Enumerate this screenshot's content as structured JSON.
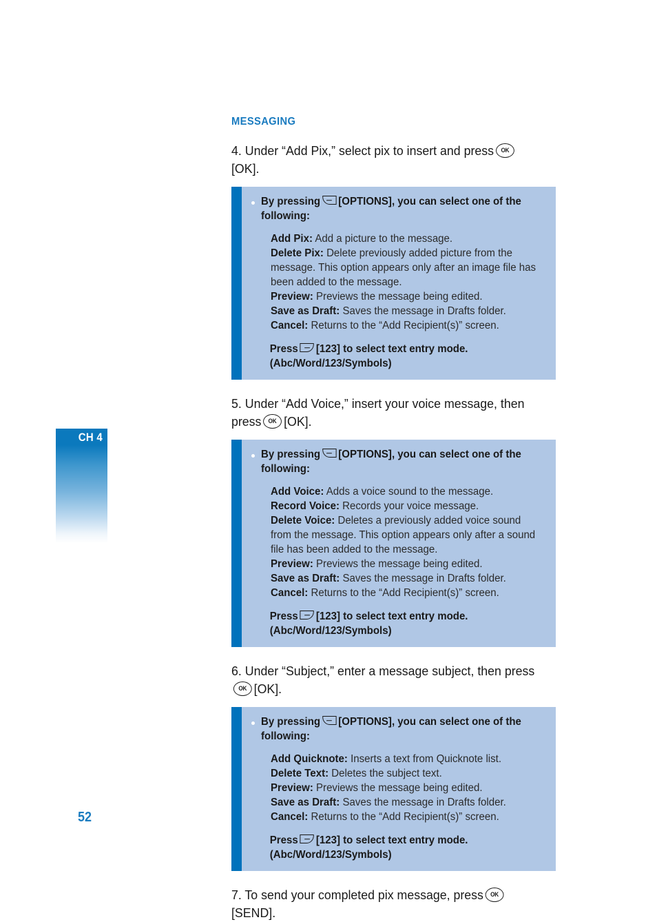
{
  "chapter_tab": {
    "label": "CH 4"
  },
  "page_number": "52",
  "section_heading": "MESSAGING",
  "icons": {
    "ok_key_label": "OK",
    "soft_key_left": "left-soft-key",
    "soft_key_right": "right-soft-key"
  },
  "steps": {
    "step4": {
      "before_icon": "4. Under “Add Pix,” select pix to insert and press",
      "after_icon": "[OK]."
    },
    "step5": {
      "before_icon": "5. Under “Add Voice,” insert your voice message, then press",
      "after_icon": "[OK]."
    },
    "step6": {
      "before_icon": "6. Under “Subject,” enter a message subject, then press",
      "after_icon": "[OK]."
    },
    "step7": {
      "before_icon": "7. To send your completed pix message, press",
      "after_icon": "[SEND]."
    }
  },
  "callouts": [
    {
      "lead_before_icon": "By pressing",
      "lead_after_icon": "[OPTIONS], you can select one of the following:",
      "options": [
        {
          "name": "Add Pix:",
          "desc": " Add a picture to the message."
        },
        {
          "name": "Delete Pix:",
          "desc": " Delete previously added picture from the message. This option appears only after an image file has been added to the message."
        },
        {
          "name": "Preview:",
          "desc": " Previews the message being edited."
        },
        {
          "name": "Save as Draft:",
          "desc": " Saves the message in Drafts folder."
        },
        {
          "name": "Cancel:",
          "desc": " Returns to the “Add Recipient(s)” screen."
        }
      ],
      "footer_before_icon": "Press",
      "footer_after_icon": "[123] to select text entry mode. (Abc/Word/123/Symbols)"
    },
    {
      "lead_before_icon": "By pressing",
      "lead_after_icon": "[OPTIONS], you can select one of  the following:",
      "options": [
        {
          "name": "Add Voice:",
          "desc": " Adds a voice sound to the message."
        },
        {
          "name": "Record Voice:",
          "desc": " Records your voice message."
        },
        {
          "name": "Delete Voice:",
          "desc": " Deletes a previously added voice sound from the message. This option appears only after a sound file has been added to the message."
        },
        {
          "name": "Preview:",
          "desc": " Previews the message being edited."
        },
        {
          "name": "Save as Draft:",
          "desc": " Saves the message in Drafts folder."
        },
        {
          "name": "Cancel:",
          "desc": " Returns to the “Add Recipient(s)” screen."
        }
      ],
      "footer_before_icon": "Press",
      "footer_after_icon": "[123] to select text entry mode. (Abc/Word/123/Symbols)"
    },
    {
      "lead_before_icon": "By pressing",
      "lead_after_icon": "[OPTIONS], you can select one of the following:",
      "options": [
        {
          "name": "Add Quicknote:",
          "desc": " Inserts a text from Quicknote list."
        },
        {
          "name": "Delete Text:",
          "desc": " Deletes the subject text."
        },
        {
          "name": "Preview:",
          "desc": " Previews the message being edited."
        },
        {
          "name": "Save as Draft:",
          "desc": " Saves the message in Drafts folder."
        },
        {
          "name": "Cancel:",
          "desc": " Returns to the “Add Recipient(s)” screen."
        }
      ],
      "footer_before_icon": "Press",
      "footer_after_icon": "[123] to select text entry mode. (Abc/Word/123/Symbols)"
    }
  ]
}
